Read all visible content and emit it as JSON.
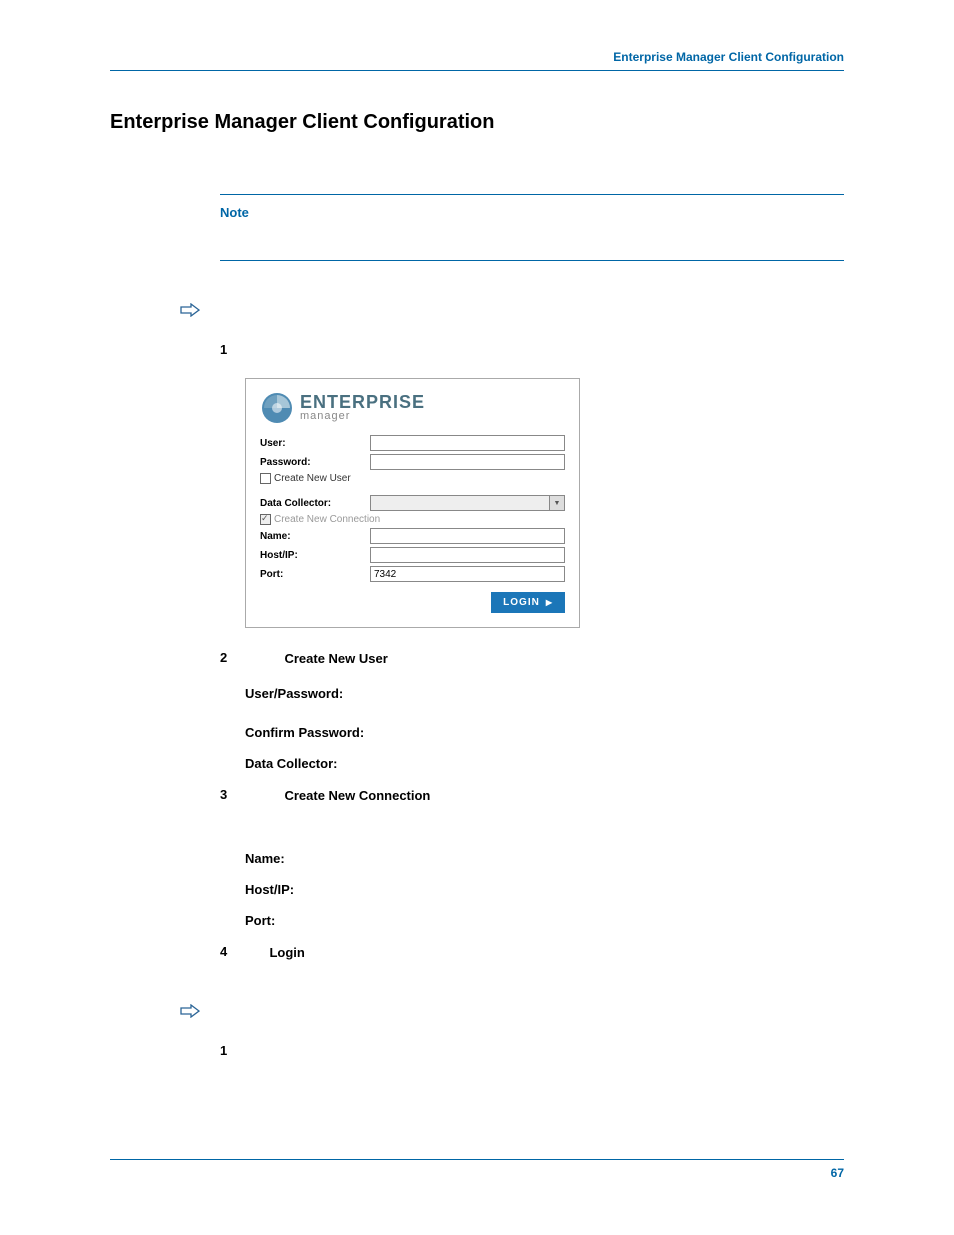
{
  "header": {
    "breadcrumb": "Enterprise Manager Client Configuration"
  },
  "title": "Enterprise Manager Client Configuration",
  "note": {
    "label": "Note"
  },
  "login_panel": {
    "logo": {
      "big": "ENTERPRISE",
      "small": "manager"
    },
    "user_label": "User:",
    "password_label": "Password:",
    "create_new_user_label": "Create New User",
    "create_new_user_checked": false,
    "data_collector_label": "Data Collector:",
    "create_new_connection_label": "Create New Connection",
    "create_new_connection_checked": true,
    "name_label": "Name:",
    "host_label": "Host/IP:",
    "port_label": "Port:",
    "port_value": "7342",
    "login_button": "LOGIN"
  },
  "steps_a": [
    {
      "num": "1",
      "label": ""
    },
    {
      "num": "2",
      "label": "Create New User"
    },
    {
      "num": "3",
      "label": "Create New Connection"
    },
    {
      "num": "4",
      "label": "Login"
    }
  ],
  "substeps_after_2": [
    "User/Password:",
    "Confirm Password:",
    "Data Collector:"
  ],
  "substeps_after_3": [
    "Name:",
    "Host/IP:",
    "Port:"
  ],
  "steps_b": [
    {
      "num": "1",
      "label": ""
    }
  ],
  "footer": {
    "page_number": "67"
  }
}
